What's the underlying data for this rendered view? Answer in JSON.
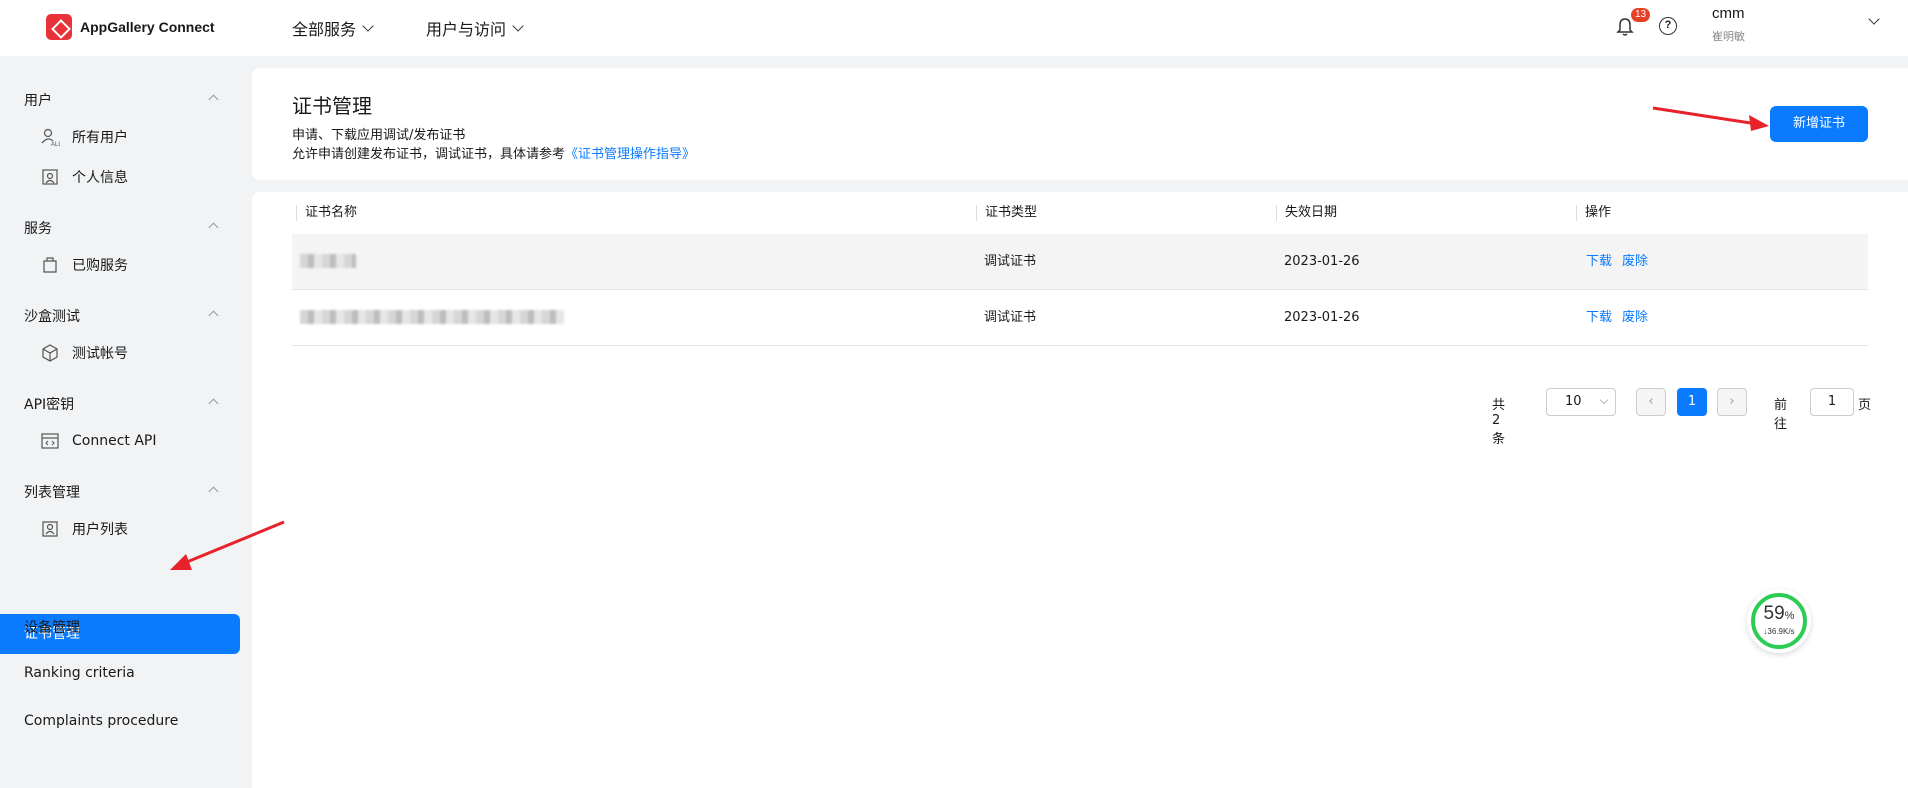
{
  "header": {
    "app_name": "AppGallery Connect",
    "nav": [
      "全部服务",
      "用户与访问"
    ],
    "notification_count": "13",
    "user_name": "cmm",
    "user_subname": "崔明敏"
  },
  "sidebar": {
    "groups": [
      {
        "title": "用户",
        "items": [
          "所有用户",
          "个人信息"
        ]
      },
      {
        "title": "服务",
        "items": [
          "已购服务"
        ]
      },
      {
        "title": "沙盒测试",
        "items": [
          "测试帐号"
        ]
      },
      {
        "title": "API密钥",
        "items": [
          "Connect API"
        ]
      },
      {
        "title": "列表管理",
        "items": [
          "用户列表"
        ]
      }
    ],
    "active": "证书管理",
    "flat_items": [
      "设备管理",
      "Ranking criteria",
      "Complaints procedure"
    ]
  },
  "page": {
    "title": "证书管理",
    "desc1": "申请、下载应用调试/发布证书",
    "desc2_prefix": "允许申请创建发布证书，调试证书，具体请参考",
    "desc2_link": "《证书管理操作指导》",
    "new_button": "新增证书"
  },
  "table": {
    "columns": [
      "证书名称",
      "证书类型",
      "失效日期",
      "操作"
    ],
    "rows": [
      {
        "type": "调试证书",
        "expiry": "2023-01-26",
        "ops": [
          "下载",
          "废除"
        ]
      },
      {
        "type": "调试证书",
        "expiry": "2023-01-26",
        "ops": [
          "下载",
          "废除"
        ]
      }
    ]
  },
  "pagination": {
    "total": "共 2 条",
    "page_size": "10",
    "current_page": "1",
    "goto_label": "前往",
    "goto_value": "1",
    "page_suffix": "页"
  },
  "widget": {
    "percent": "59",
    "percent_unit": "%",
    "rate": "↓36.9K/s"
  },
  "colors": {
    "primary": "#0a7bff",
    "badge": "#e84026",
    "arrow": "#e8222a",
    "ring": "#2ecc55"
  }
}
